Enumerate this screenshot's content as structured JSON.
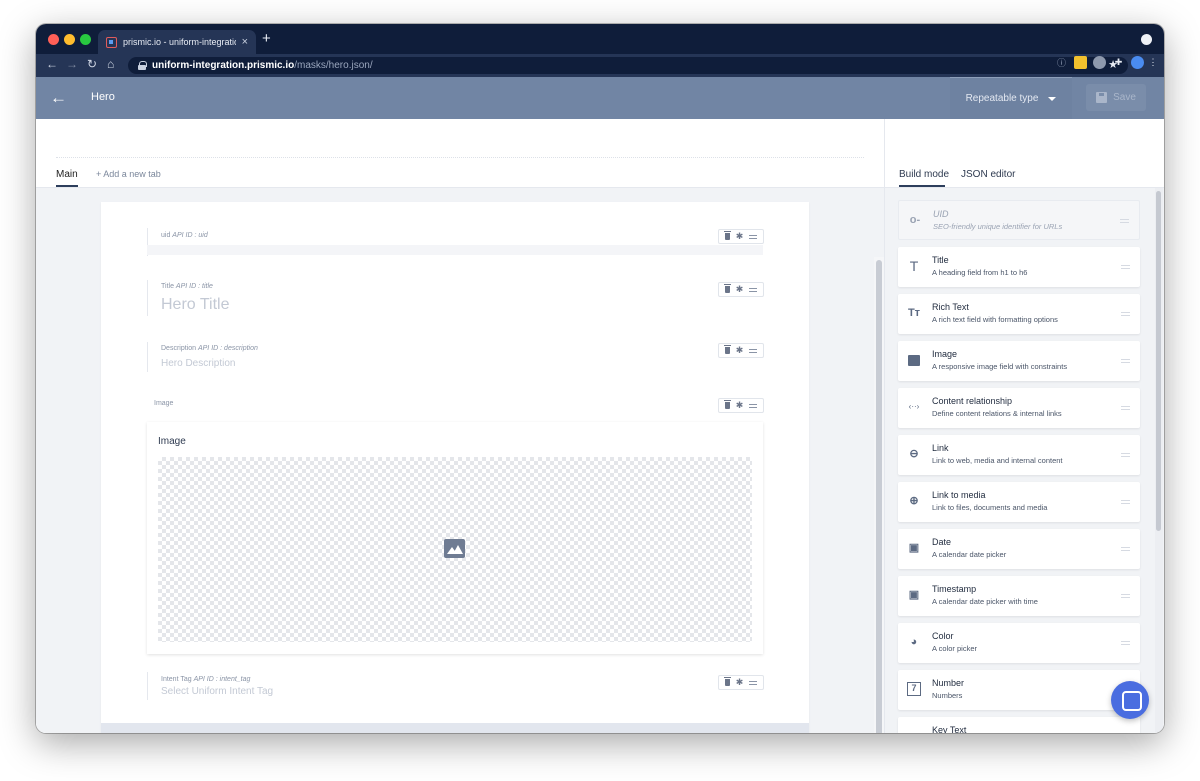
{
  "browser": {
    "tab_title": "prismic.io - uniform-integration",
    "tab_close": "×",
    "new_tab": "+",
    "url_host": "uniform-integration.prismic.io",
    "url_path": "/masks/hero.json/"
  },
  "header": {
    "back": "←",
    "title": "Hero",
    "type_dropdown": "Repeatable type",
    "save_label": "Save"
  },
  "tabs": {
    "main": "Main",
    "add_tab": "+ Add a new tab"
  },
  "fields": [
    {
      "name": "uid",
      "api_prefix": "API ID :",
      "api_id": "uid",
      "placeholder": ""
    },
    {
      "name": "Title",
      "api_prefix": "API ID :",
      "api_id": "title",
      "placeholder": "Hero Title"
    },
    {
      "name": "Description",
      "api_prefix": "API ID :",
      "api_id": "description",
      "placeholder": "Hero Description"
    },
    {
      "name": "Image",
      "api_prefix": "",
      "api_id": "",
      "placeholder": "",
      "box_title": "Image"
    },
    {
      "name": "Intent Tag",
      "api_prefix": "API ID :",
      "api_id": "intent_tag",
      "placeholder": "Select Uniform Intent Tag"
    }
  ],
  "side": {
    "tabs": [
      "Build mode",
      "JSON editor"
    ],
    "items": [
      {
        "icon": "key-icon",
        "title": "UID",
        "desc": "SEO-friendly unique identifier for URLs"
      },
      {
        "icon": "title-icon",
        "title": "Title",
        "desc": "A heading field from h1 to h6"
      },
      {
        "icon": "rich-text-icon",
        "title": "Rich Text",
        "desc": "A rich text field with formatting options"
      },
      {
        "icon": "image-icon",
        "title": "Image",
        "desc": "A responsive image field with constraints"
      },
      {
        "icon": "code-icon",
        "title": "Content relationship",
        "desc": "Define content relations & internal links"
      },
      {
        "icon": "link-icon",
        "title": "Link",
        "desc": "Link to web, media and internal content"
      },
      {
        "icon": "paperclip-icon",
        "title": "Link to media",
        "desc": "Link to files, documents and media"
      },
      {
        "icon": "calendar-icon",
        "title": "Date",
        "desc": "A calendar date picker"
      },
      {
        "icon": "calendar-icon",
        "title": "Timestamp",
        "desc": "A calendar date picker with time"
      },
      {
        "icon": "palette-icon",
        "title": "Color",
        "desc": "A color picker"
      },
      {
        "icon": "number-icon",
        "title": "Number",
        "desc": "Numbers"
      },
      {
        "icon": "text-icon",
        "title": "Key Text",
        "desc": ""
      }
    ]
  },
  "glyphs": {
    "uid": "o-",
    "title": "T",
    "rich": "Tт",
    "code": "‹··›",
    "link": "⊖",
    "clip": "⊕",
    "cal": "▣",
    "palette": "◕",
    "number": "7",
    "gear": "✱"
  },
  "colors": {
    "chrome": "#0f1d3a",
    "header": "#7185a4",
    "accent": "#4a6de0"
  }
}
